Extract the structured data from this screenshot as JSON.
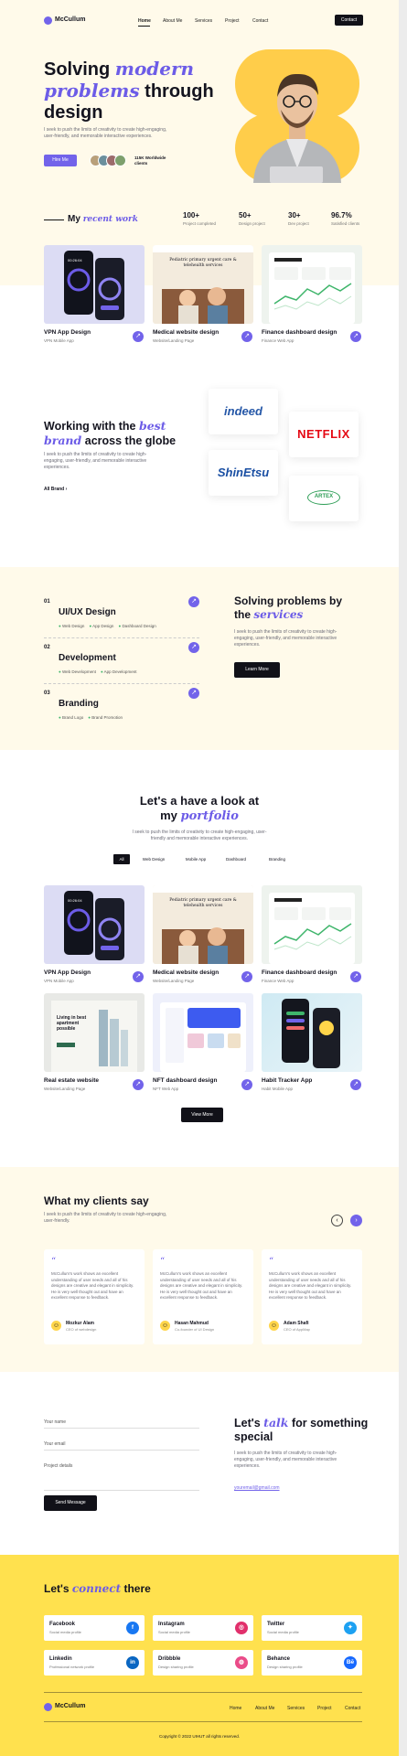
{
  "brand": {
    "name": "McCullum"
  },
  "nav": {
    "home": "Home",
    "about": "About Me",
    "services": "Services",
    "project": "Project",
    "contact": "Contact",
    "contact_button": "Contact"
  },
  "hero": {
    "title_a": "Solving",
    "title_b": "modern",
    "title_c": "problems",
    "title_d": "through",
    "title_e": "design",
    "desc": "I seek to push the limits of creativity to create high-engaging, user-friendly, and memorable interactive experiences.",
    "hire_button": "Hire Me",
    "clients_count": "115K Worldwide",
    "clients_label": "clients"
  },
  "work_header": {
    "a": "My",
    "b": "recent work"
  },
  "stats": [
    {
      "value": "100+",
      "label": "Project completed"
    },
    {
      "value": "50+",
      "label": "Design project"
    },
    {
      "value": "30+",
      "label": "Dev project"
    },
    {
      "value": "96.7%",
      "label": "Satisfied clients"
    }
  ],
  "recent": [
    {
      "title": "VPN App Design",
      "sub": "VPN Mobile App"
    },
    {
      "title": "Medical website design",
      "sub": "Website/Landing Page"
    },
    {
      "title": "Finance dashboard design",
      "sub": "Finance Web App"
    }
  ],
  "mock": {
    "vpn_time": "00:26:04",
    "med_heading": "Pediatric primary urgent care & telehealth services"
  },
  "brands": {
    "a": "Working with the",
    "b": "best",
    "c": "brand",
    "d": "across the globe",
    "desc": "I seek to push the limits of creativity to create high-engaging, user-friendly, and memorable interactive experiences.",
    "link": "All Brand",
    "logos": [
      "indeed",
      "NETFLIX",
      "ShinEtsu",
      "ARTEX"
    ]
  },
  "services": {
    "items": [
      {
        "num": "01",
        "title": "UI/UX Design",
        "tags": [
          "Web Design",
          "App Design",
          "Dashboard Design"
        ]
      },
      {
        "num": "02",
        "title": "Development",
        "tags": [
          "Web Development",
          "App Development"
        ]
      },
      {
        "num": "03",
        "title": "Branding",
        "tags": [
          "Brand Logo",
          "Brand Promotion"
        ]
      }
    ],
    "a": "Solving problems by",
    "b": "the",
    "c": "services",
    "desc": "I seek to push the limits of creativity to create high-engaging, user-friendly, and memorable interactive experiences.",
    "learn": "Learn More"
  },
  "portfolio": {
    "a": "Let's a have a look at",
    "b": "my",
    "c": "portfolio",
    "desc": "I seek to push the limits of creativity to create high-engaging, user-friendly and memorable interactive experiences.",
    "filters": [
      "All",
      "Web Design",
      "Mobile App",
      "Dashboard",
      "Branding"
    ],
    "items": [
      {
        "title": "VPN App Design",
        "sub": "VPN Mobile App"
      },
      {
        "title": "Medical website design",
        "sub": "Website/Landing Page"
      },
      {
        "title": "Finance dashboard design",
        "sub": "Finance Web App"
      },
      {
        "title": "Real estate website",
        "sub": "Website/Landing Page"
      },
      {
        "title": "NFT dashboard design",
        "sub": "NFT Web App"
      },
      {
        "title": "Habit Tracker App",
        "sub": "Habit Mobile App"
      }
    ],
    "estate_heading": "Living in best apartment possible",
    "view_more": "View More"
  },
  "testimonials": {
    "title": "What my clients say",
    "desc": "I seek to push the limits of creativity to create high-engaging, user-friendly.",
    "quote": "McCullum's work shows an excellent understanding of user needs and all of his designs are creative and elegant in simplicity. He is very well thought out and have an excellent response to feedback.",
    "people": [
      {
        "name": "Mozkur Alam",
        "role": "CEO of webdesign"
      },
      {
        "name": "Hasan Mahmud",
        "role": "Co-founder of UI Design"
      },
      {
        "name": "Adam Shafi",
        "role": "CEO of AppMap"
      }
    ]
  },
  "contact": {
    "name_placeholder": "Your name",
    "email_placeholder": "Your email",
    "details_placeholder": "Project details",
    "send": "Send Message",
    "a": "Let's",
    "b": "talk",
    "c": "for something special",
    "desc": "I seek to push the limits of creativity to create high-engaging, user-friendly, and memorable interactive experiences.",
    "email": "youremail@gmail.com"
  },
  "social": {
    "a": "Let's",
    "b": "connect",
    "c": "there",
    "items": [
      {
        "name": "Facebook",
        "sub": "Social media profile",
        "color": "#1877f2",
        "glyph": "f"
      },
      {
        "name": "Instagram",
        "sub": "Social media profile",
        "color": "#e1306c",
        "glyph": "◎"
      },
      {
        "name": "Twitter",
        "sub": "Social media profile",
        "color": "#1da1f2",
        "glyph": "✦"
      },
      {
        "name": "Linkedin",
        "sub": "Professional network profile",
        "color": "#0a66c2",
        "glyph": "in"
      },
      {
        "name": "Dribbble",
        "sub": "Design sharing profile",
        "color": "#ea4c89",
        "glyph": "◍"
      },
      {
        "name": "Behance",
        "sub": "Design sharing profile",
        "color": "#1769ff",
        "glyph": "Bē"
      }
    ]
  },
  "footer": {
    "brand": "McCullum",
    "copyright": "Copyright © 2022 UIHUT all rights reserved."
  },
  "colors": {
    "accent": "#7263ea",
    "cream": "#fffaea",
    "yellow": "#ffe14e",
    "dark": "#111118"
  }
}
